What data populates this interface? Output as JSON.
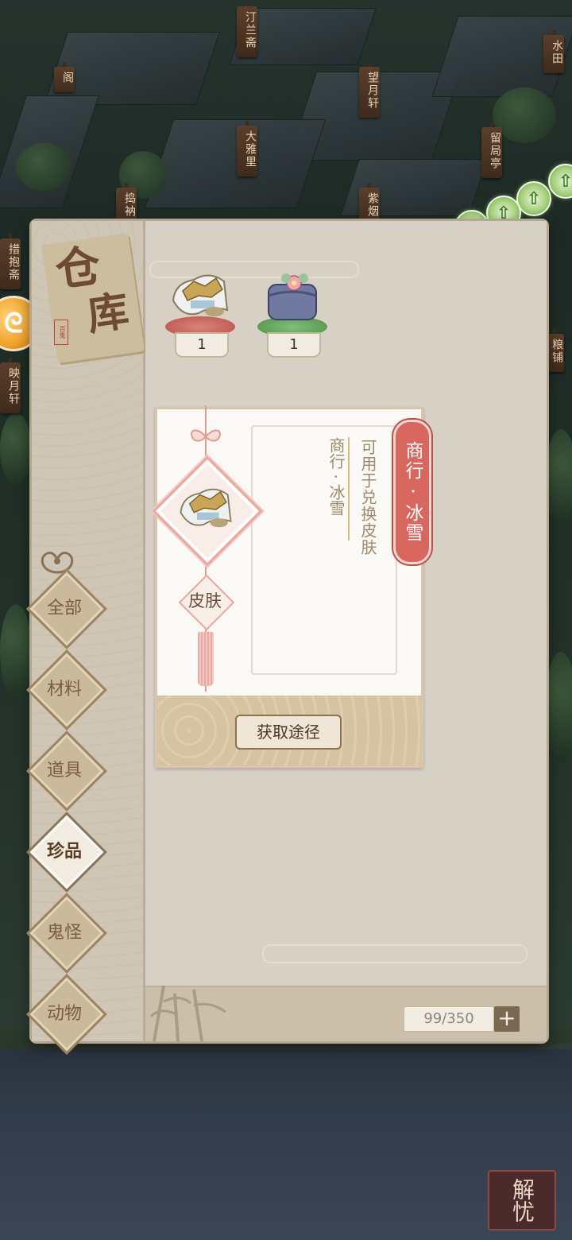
{
  "map_signs": [
    "汀兰斋",
    "阁",
    "望月轩",
    "水田",
    "大雅里",
    "留局亭",
    "捣衲",
    "紫烟",
    "措抱斋",
    "粮铺",
    "映月轩"
  ],
  "panel": {
    "title_char1": "仓",
    "title_char2": "库",
    "seal_text": "百鬼"
  },
  "categories": [
    {
      "label": "全部",
      "active": false
    },
    {
      "label": "材料",
      "active": false
    },
    {
      "label": "道具",
      "active": false
    },
    {
      "label": "珍品",
      "active": true
    },
    {
      "label": "鬼怪",
      "active": false
    },
    {
      "label": "动物",
      "active": false
    }
  ],
  "items": [
    {
      "name": "商行·冰雪",
      "icon": "scroll-icon",
      "count": "1",
      "pedestal_color": "#c95e55"
    },
    {
      "name": "",
      "icon": "gift-box-icon",
      "count": "1",
      "pedestal_color": "#5fa65a"
    }
  ],
  "detail": {
    "item_name": "商行 · 冰雪",
    "type_label": "皮肤",
    "description": "可用于兑换皮肤",
    "source": "商行 · 冰雪",
    "get_button": "获取途径"
  },
  "capacity": {
    "value": "99/350",
    "plus_label": "+"
  },
  "bottom_badge": "解忧",
  "colors": {
    "ribbon": "#d8675f",
    "panel_bg": "#dbd3c5",
    "accent_brown": "#7a6850"
  }
}
